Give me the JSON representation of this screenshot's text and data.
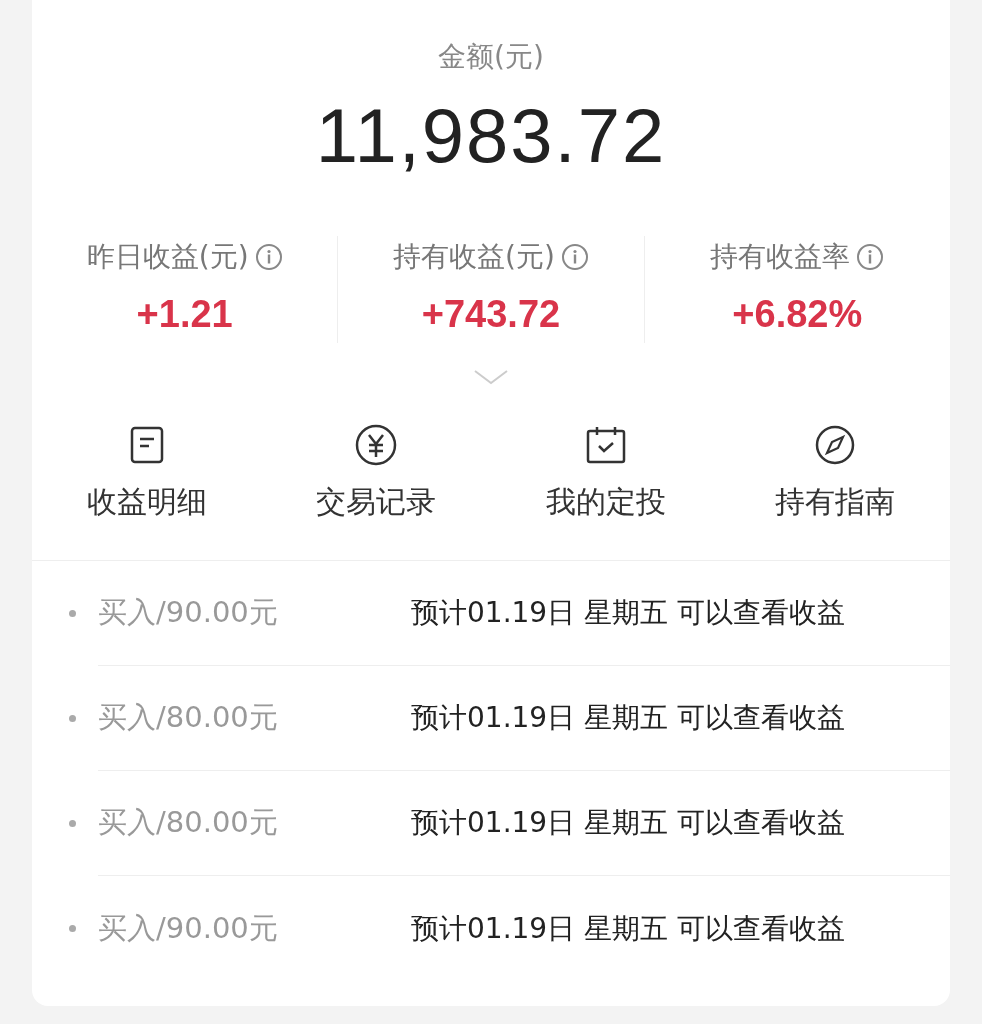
{
  "balance": {
    "label": "金额(元)",
    "value": "11,983.72"
  },
  "stats": [
    {
      "label": "昨日收益(元)",
      "value": "+1.21"
    },
    {
      "label": "持有收益(元)",
      "value": "+743.72"
    },
    {
      "label": "持有收益率",
      "value": "+6.82%"
    }
  ],
  "shortcuts": [
    {
      "label": "收益明细"
    },
    {
      "label": "交易记录"
    },
    {
      "label": "我的定投"
    },
    {
      "label": "持有指南"
    }
  ],
  "records": [
    {
      "amount": "买入/90.00元",
      "note": "预计01.19日 星期五 可以查看收益"
    },
    {
      "amount": "买入/80.00元",
      "note": "预计01.19日 星期五 可以查看收益"
    },
    {
      "amount": "买入/80.00元",
      "note": "预计01.19日 星期五 可以查看收益"
    },
    {
      "amount": "买入/90.00元",
      "note": "预计01.19日 星期五 可以查看收益"
    }
  ]
}
